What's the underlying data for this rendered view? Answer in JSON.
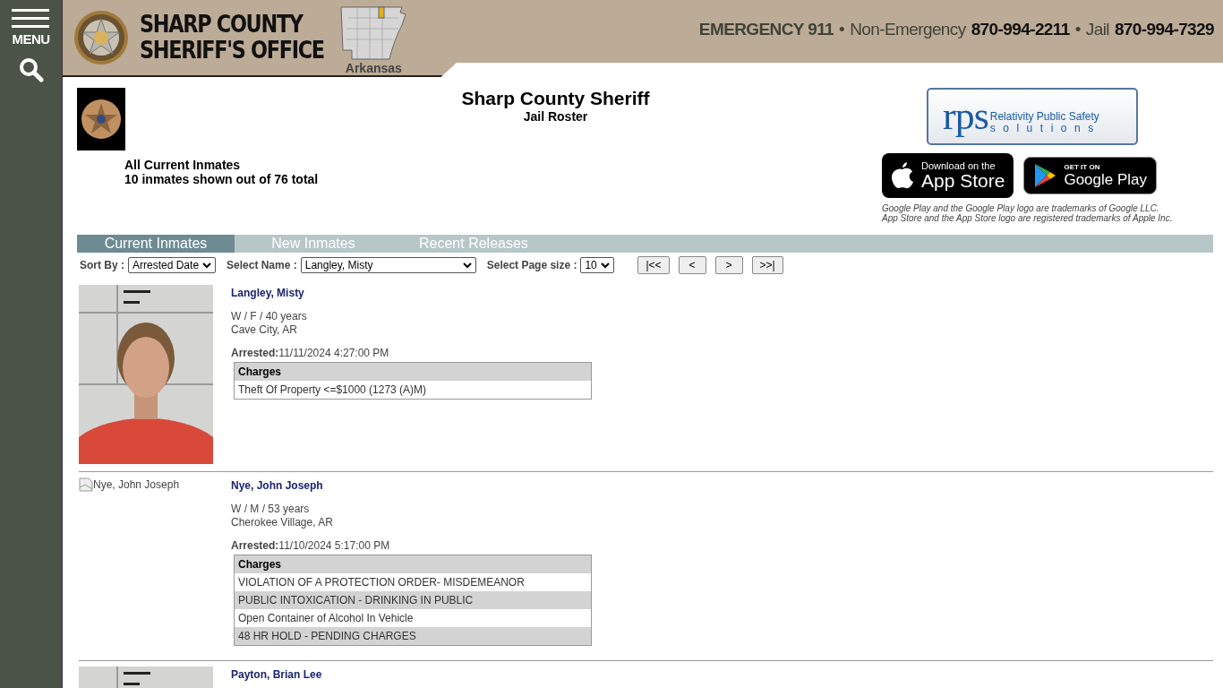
{
  "sidebar": {
    "menu_label": "MENU"
  },
  "header": {
    "title_lines": [
      "SHARP COUNTY",
      "SHERIFF'S OFFICE"
    ],
    "map_label": "Arkansas",
    "contacts": [
      {
        "kind": "emph",
        "text": "EMERGENCY 911"
      },
      {
        "kind": "sep",
        "text": "•"
      },
      {
        "kind": "label",
        "text": "Non-Emergency"
      },
      {
        "kind": "number",
        "text": "870-994-2211"
      },
      {
        "kind": "sep",
        "text": "•"
      },
      {
        "kind": "label",
        "text": "Jail"
      },
      {
        "kind": "number",
        "text": "870-994-7329"
      }
    ]
  },
  "roster": {
    "title": "Sharp County Sheriff",
    "subtitle": "Jail Roster",
    "summary": [
      "All Current Inmates",
      "10 inmates shown out of 76 total"
    ]
  },
  "vendor": {
    "initials": "rps",
    "name": "Relativity Public Safety",
    "tagline": "solutions"
  },
  "app_badges": [
    {
      "kind": "apple",
      "small": "Download on the",
      "big": "App Store"
    },
    {
      "kind": "google",
      "small": "GET IT ON",
      "big": "Google Play"
    }
  ],
  "trademarks": [
    "Google Play and the Google Play logo are trademarks of Google LLC.",
    "App Store and the App Store logo are registered trademarks of Apple Inc."
  ],
  "tabs": [
    {
      "label": "Current Inmates",
      "selected": true
    },
    {
      "label": "New Inmates",
      "selected": false
    },
    {
      "label": "Recent Releases",
      "selected": false
    }
  ],
  "filters": [
    {
      "label": "Sort By :",
      "value": "Arrested Date"
    },
    {
      "label": "Select Name :",
      "value": "Langley, Misty"
    },
    {
      "label": "Select Page size :",
      "value": "10"
    }
  ],
  "pager": [
    "|<<",
    "<",
    ">",
    ">>|"
  ],
  "inmates": [
    {
      "name": "Langley, Misty",
      "photo": {
        "kind": "picture"
      },
      "demographics": "W / F / 40 years",
      "city": "Cave City, AR",
      "arrested_label": "Arrested:",
      "arrested": "11/11/2024 4:27:00 PM",
      "charges_header": "Charges",
      "charges": [
        "Theft Of Property <=$1000 (1273 (A)M)"
      ]
    },
    {
      "name": "Nye, John Joseph",
      "photo": {
        "kind": "broken",
        "alt": "Nye, John Joseph"
      },
      "demographics": "W / M / 53 years",
      "city": "Cherokee Village, AR",
      "arrested_label": "Arrested:",
      "arrested": "11/10/2024 5:17:00 PM",
      "charges_header": "Charges",
      "charges": [
        "VIOLATION OF A PROTECTION ORDER- MISDEMEANOR",
        "PUBLIC INTOXICATION - DRINKING IN PUBLIC",
        "Open Container of Alcohol In Vehicle",
        "48 HR HOLD - PENDING CHARGES"
      ]
    },
    {
      "name": "Payton, Brian Lee",
      "photo": {
        "kind": "picture"
      }
    }
  ]
}
